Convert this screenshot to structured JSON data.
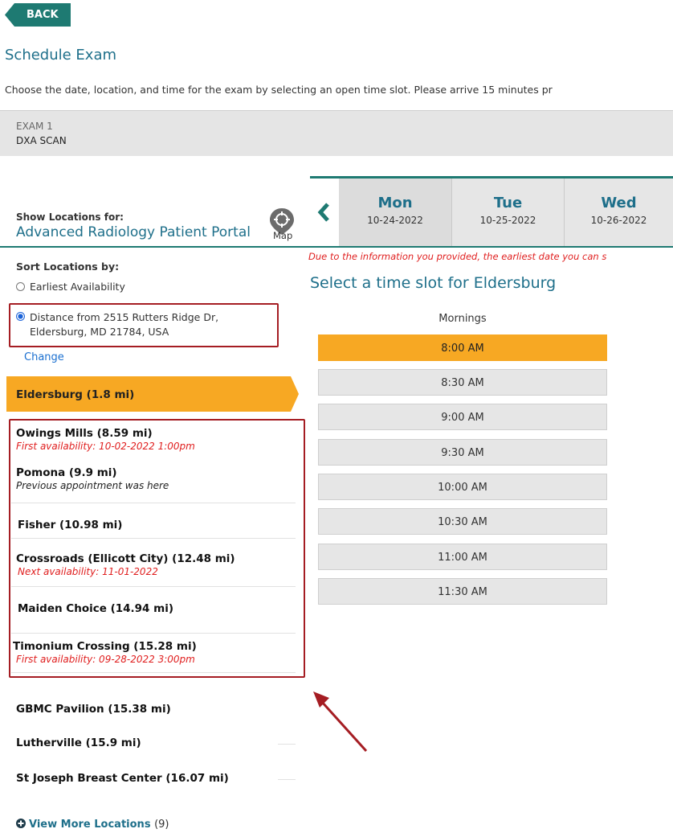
{
  "header": {
    "back_label": "BACK",
    "title": "Schedule Exam",
    "intro": "Choose the date, location, and time for the exam by selecting an open time slot. Please arrive 15 minutes pr"
  },
  "exam": {
    "number": "EXAM 1",
    "name": "DXA SCAN"
  },
  "locations_panel": {
    "show_for_label": "Show Locations for:",
    "portal": "Advanced Radiology Patient Portal",
    "map_label": "Map",
    "sort_label": "Sort Locations by:",
    "sort_options": [
      {
        "label": "Earliest Availability",
        "selected": false
      },
      {
        "label": "Distance from 2515 Rutters Ridge Dr, Eldersburg, MD 21784, USA",
        "selected": true
      }
    ],
    "change_label": "Change",
    "selected_location": "Eldersburg (1.8 mi)",
    "locations": [
      {
        "name": "Owings Mills (8.59 mi)",
        "note": "First availability:  10-02-2022  1:00pm",
        "note_style": "red"
      },
      {
        "name": "Pomona (9.9 mi)",
        "note": "Previous appointment was here",
        "note_style": "plain"
      },
      {
        "name": "Fisher (10.98 mi)",
        "note": "",
        "note_style": ""
      },
      {
        "name": "Crossroads (Ellicott City) (12.48 mi)",
        "note": "Next availability:  11-01-2022",
        "note_style": "red"
      },
      {
        "name": "Maiden Choice (14.94 mi)",
        "note": "",
        "note_style": ""
      },
      {
        "name": "Timonium Crossing (15.28 mi)",
        "note": "First availability:  09-28-2022  3:00pm",
        "note_style": "red"
      },
      {
        "name": "GBMC Pavilion (15.38 mi)",
        "note": "",
        "note_style": ""
      },
      {
        "name": "Lutherville (15.9 mi)",
        "note": "",
        "note_style": ""
      },
      {
        "name": "St Joseph Breast Center (16.07 mi)",
        "note": "",
        "note_style": ""
      }
    ],
    "view_more_label": "View More Locations",
    "view_more_count": "(9)"
  },
  "dates": [
    {
      "day": "Mon",
      "date": "10-24-2022",
      "active": true
    },
    {
      "day": "Tue",
      "date": "10-25-2022",
      "active": false
    },
    {
      "day": "Wed",
      "date": "10-26-2022",
      "active": false
    }
  ],
  "slots": {
    "warning": "Due to the information you provided, the earliest date you can s",
    "title": "Select a time slot for Eldersburg",
    "period": "Mornings",
    "times": [
      "8:00 AM",
      "8:30 AM",
      "9:00 AM",
      "9:30 AM",
      "10:00 AM",
      "10:30 AM",
      "11:00 AM",
      "11:30 AM"
    ],
    "selected_index": 0
  },
  "colors": {
    "accent": "#1e7a72",
    "link": "#1e6f8a",
    "highlight": "#f7a823",
    "annotation": "#a51d23",
    "alert": "#e02020"
  }
}
